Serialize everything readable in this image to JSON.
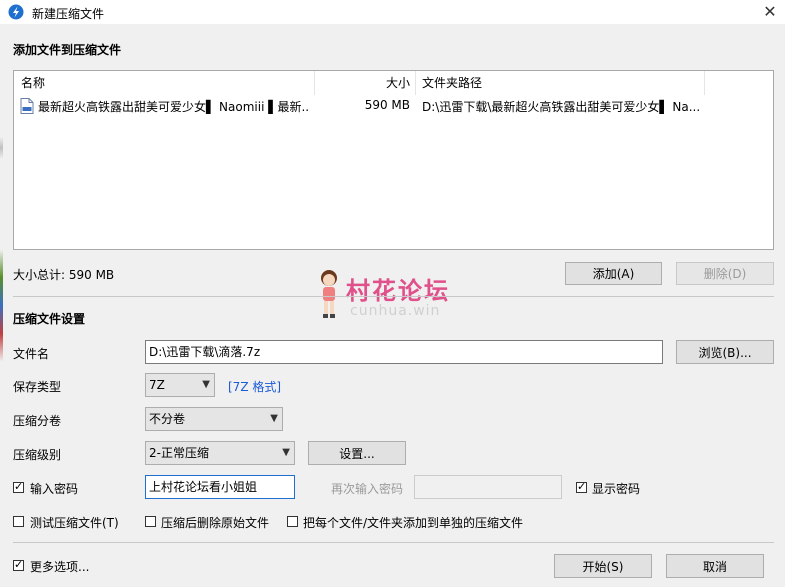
{
  "window": {
    "title": "新建压缩文件",
    "close_glyph": "✕"
  },
  "add_section": {
    "title": "添加文件到压缩文件"
  },
  "file_list": {
    "columns": [
      "名称",
      "大小",
      "文件夹路径"
    ],
    "rows": [
      {
        "name": "最新超火高铁露出甜美可爱少女▌ Naomiii ▌最新...",
        "size": "590 MB",
        "path": "D:\\迅雷下载\\最新超火高铁露出甜美可爱少女▌ Na..."
      }
    ]
  },
  "size_total": "大小总计: 590 MB",
  "buttons": {
    "add": "添加(A)",
    "delete": "删除(D)",
    "browse": "浏览(B)...",
    "settings": "设置...",
    "start": "开始(S)",
    "cancel": "取消"
  },
  "watermark": {
    "title": "村花论坛",
    "sub": "cunhua.win"
  },
  "settings_section": {
    "title": "压缩文件设置"
  },
  "fields": {
    "filename_label": "文件名",
    "filename_value": "D:\\迅雷下载\\滴落.7z",
    "save_type_label": "保存类型",
    "save_type_value": "7Z",
    "save_type_link": "[7Z 格式]",
    "split_label": "压缩分卷",
    "split_value": "不分卷",
    "level_label": "压缩级别",
    "level_value": "2-正常压缩",
    "password_label": "输入密码",
    "password_value": "上村花论坛看小姐姐",
    "repeat_password_label": "再次输入密码",
    "repeat_password_value": "",
    "show_password_label": "显示密码"
  },
  "options": {
    "test_archive": "测试压缩文件(T)",
    "delete_after": "压缩后删除原始文件",
    "each_separate": "把每个文件/文件夹添加到单独的压缩文件",
    "more_options": "更多选项..."
  }
}
